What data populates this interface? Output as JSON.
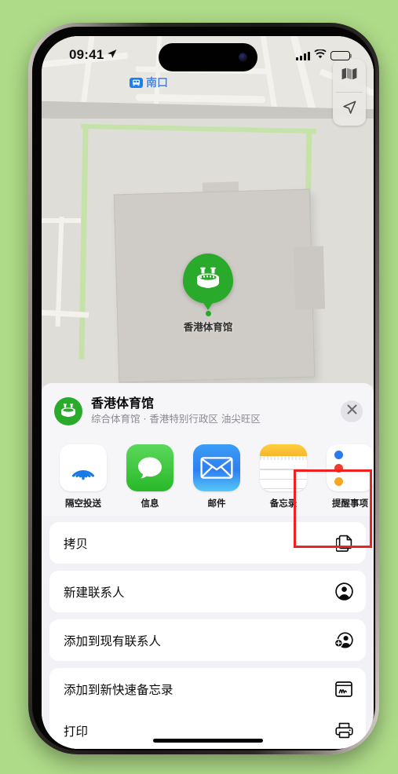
{
  "status_bar": {
    "time": "09:41",
    "location_arrow_icon": "location-arrow-icon",
    "signal_icon": "cellular-signal-icon",
    "wifi_icon": "wifi-icon",
    "battery_icon": "battery-icon"
  },
  "map": {
    "transit_label": "南口",
    "transit_badge_icon": "subway-icon",
    "pin_label": "香港体育馆",
    "pin_icon": "stadium-icon",
    "controls": [
      {
        "name": "map-layers-button",
        "icon": "map-layers-icon"
      },
      {
        "name": "locate-me-button",
        "icon": "location-arrow-icon"
      }
    ],
    "colors": {
      "pin": "#2aaa2a",
      "transit": "#4a86e8"
    }
  },
  "share_sheet": {
    "title": "香港体育馆",
    "subtitle": "综合体育馆 · 香港特别行政区 油尖旺区",
    "avatar_icon": "stadium-icon",
    "close_icon": "close-icon",
    "apps": [
      {
        "label": "隔空投送",
        "icon": "airdrop-icon",
        "highlighted": false
      },
      {
        "label": "信息",
        "icon": "messages-icon",
        "highlighted": false
      },
      {
        "label": "邮件",
        "icon": "mail-icon",
        "highlighted": false
      },
      {
        "label": "备忘录",
        "icon": "notes-icon",
        "highlighted": true
      },
      {
        "label": "提醒事项",
        "icon": "reminders-icon",
        "highlighted": false
      }
    ],
    "actions": [
      {
        "label": "拷贝",
        "icon": "copy-icon"
      },
      {
        "label": "新建联系人",
        "icon": "person-circle-icon"
      },
      {
        "label": "添加到现有联系人",
        "icon": "person-add-icon"
      },
      {
        "label": "添加到新快速备忘录",
        "icon": "quick-note-icon"
      },
      {
        "label": "打印",
        "icon": "printer-icon"
      }
    ],
    "highlight_color": "#ee2222"
  }
}
